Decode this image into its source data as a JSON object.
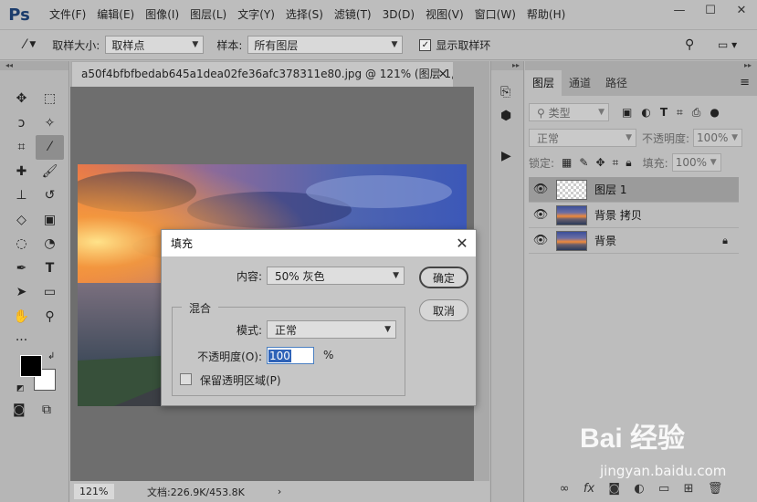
{
  "app": {
    "logo": "Ps",
    "menu": [
      "文件(F)",
      "编辑(E)",
      "图像(I)",
      "图层(L)",
      "文字(Y)",
      "选择(S)",
      "滤镜(T)",
      "3D(D)",
      "视图(V)",
      "窗口(W)",
      "帮助(H)"
    ]
  },
  "options": {
    "sample_size_label": "取样大小:",
    "sample_size_value": "取样点",
    "sample_label": "样本:",
    "sample_value": "所有图层",
    "show_ring_label": "显示取样环"
  },
  "document": {
    "tab_title": "a50f4bfbfbedab645a1dea02fe36afc378311e80.jpg @ 121% (图层 1, ...",
    "zoom": "121%",
    "doc_info": "文档:226.9K/453.8K"
  },
  "layers_panel": {
    "tabs": [
      "图层",
      "通道",
      "路径"
    ],
    "filter_placeholder": "类型",
    "blend_mode": "正常",
    "opacity_label": "不透明度:",
    "opacity_value": "100%",
    "lock_label": "锁定:",
    "fill_label": "填充:",
    "fill_value": "100%",
    "layers": [
      {
        "name": "图层 1",
        "selected": true,
        "thumb": "transparent"
      },
      {
        "name": "背景 拷贝",
        "selected": false,
        "thumb": "photo"
      },
      {
        "name": "背景",
        "selected": false,
        "thumb": "photo",
        "locked": true
      }
    ]
  },
  "dialog": {
    "title": "填充",
    "content_label": "内容:",
    "content_value": "50% 灰色",
    "ok_label": "确定",
    "cancel_label": "取消",
    "blend_group_label": "混合",
    "mode_label": "模式:",
    "mode_value": "正常",
    "opacity_label": "不透明度(O):",
    "opacity_value": "100",
    "opacity_unit": "%",
    "preserve_label": "保留透明区域(P)"
  },
  "watermark": {
    "brand": "Bai 经验",
    "url": "jingyan.baidu.com"
  }
}
